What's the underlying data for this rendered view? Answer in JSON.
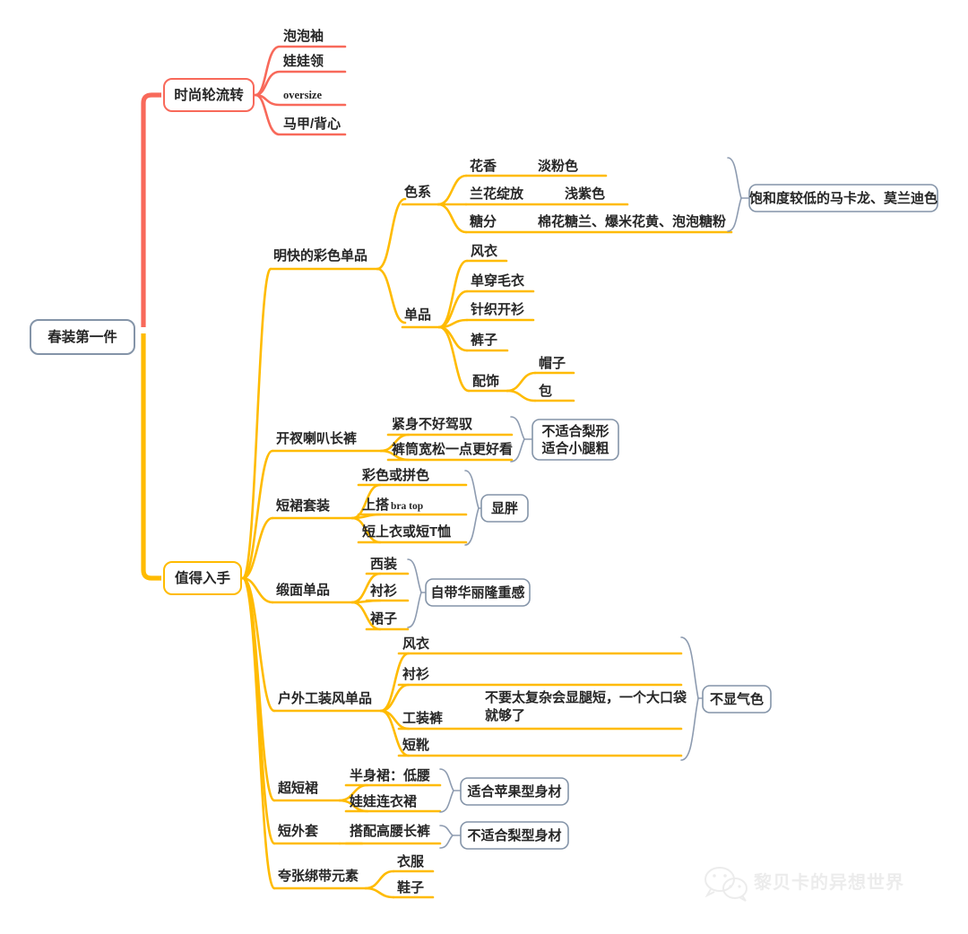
{
  "diagram": {
    "type": "mind-map",
    "root": {
      "label": "春装第一件",
      "color": "#8494a8"
    },
    "watermark": {
      "text": "黎贝卡的异想世界",
      "icon": "wechat-icon",
      "color": "#ebebeb"
    },
    "palette": {
      "branch_red": "#f8695a",
      "branch_orange": "#ffbb00",
      "node_border_gray": "#8494a8",
      "text": "#262626",
      "bracket": "#8d9bb0",
      "background": "#ffffff"
    },
    "branches": [
      {
        "label": "时尚轮流转",
        "color": "#f8695a",
        "children": [
          {
            "label": "泡泡袖"
          },
          {
            "label": "娃娃领"
          },
          {
            "label": "oversize",
            "style": "serif"
          },
          {
            "label": "马甲/背心"
          }
        ]
      },
      {
        "label": "值得入手",
        "color": "#ffbb00",
        "children": [
          {
            "label": "明快的彩色单品",
            "children": [
              {
                "label": "色系",
                "note": "饱和度较低的马卡龙、莫兰迪色",
                "children": [
                  {
                    "label": "花香",
                    "value": "淡粉色"
                  },
                  {
                    "label": "兰花绽放",
                    "value": "浅紫色"
                  },
                  {
                    "label": "糖分",
                    "value": "棉花糖兰、爆米花黄、泡泡糖粉"
                  }
                ]
              },
              {
                "label": "单品",
                "children": [
                  {
                    "label": "风衣"
                  },
                  {
                    "label": "单穿毛衣"
                  },
                  {
                    "label": "针织开衫"
                  },
                  {
                    "label": "裤子"
                  },
                  {
                    "label": "配饰",
                    "children": [
                      {
                        "label": "帽子"
                      },
                      {
                        "label": "包"
                      }
                    ]
                  }
                ]
              }
            ]
          },
          {
            "label": "开衩喇叭长裤",
            "note": "不适合梨形\n适合小腿粗",
            "note_lines": [
              "不适合梨形",
              "适合小腿粗"
            ],
            "children": [
              {
                "label": "紧身不好驾驭"
              },
              {
                "label": "裤筒宽松一点更好看"
              }
            ]
          },
          {
            "label": "短裙套装",
            "note": "显胖",
            "note_lines": [
              "显胖"
            ],
            "children": [
              {
                "label": "彩色或拼色"
              },
              {
                "label": "上搭bra top",
                "mixed": true,
                "label_cn": "上搭",
                "label_en": "bra top"
              },
              {
                "label": "短上衣或短T恤"
              }
            ]
          },
          {
            "label": "缎面单品",
            "note": "自带华丽隆重感",
            "note_lines": [
              "自带华丽隆重感"
            ],
            "children": [
              {
                "label": "西装"
              },
              {
                "label": "衬衫"
              },
              {
                "label": "裙子"
              }
            ]
          },
          {
            "label": "户外工装风单品",
            "note": "不显气色",
            "note_lines": [
              "不显气色"
            ],
            "children": [
              {
                "label": "风衣"
              },
              {
                "label": "衬衫"
              },
              {
                "label": "工装裤",
                "value_lines": [
                  "不要太复杂会显腿短，一个大口袋",
                  "就够了"
                ]
              },
              {
                "label": "短靴"
              }
            ]
          },
          {
            "label": "超短裙",
            "note": "适合苹果型身材",
            "note_lines": [
              "适合苹果型身材"
            ],
            "children": [
              {
                "label": "半身裙：低腰"
              },
              {
                "label": "娃娃连衣裙"
              }
            ]
          },
          {
            "label": "短外套",
            "note": "不适合梨型身材",
            "note_lines": [
              "不适合梨型身材"
            ],
            "children": [
              {
                "label": "搭配高腰长裤"
              }
            ]
          },
          {
            "label": "夸张绑带元素",
            "children": [
              {
                "label": "衣服"
              },
              {
                "label": "鞋子"
              }
            ]
          }
        ]
      }
    ]
  }
}
